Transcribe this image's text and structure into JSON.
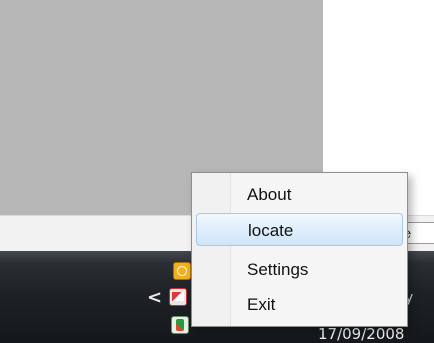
{
  "background": {
    "status_box_text": "he"
  },
  "taskbar": {
    "chevron": "<",
    "date": "17/09/2008",
    "clock_fragment": "y",
    "tray_icons": [
      {
        "name": "clock-icon"
      },
      {
        "name": "mail-icon"
      },
      {
        "name": "music-icon"
      }
    ]
  },
  "context_menu": {
    "items": [
      {
        "label": "About"
      },
      {
        "label": "locate",
        "highlighted": true
      },
      {
        "label": "Settings"
      },
      {
        "label": "Exit"
      }
    ]
  },
  "colors": {
    "menu_highlight": "#dfeefb",
    "menu_border": "#8e8e8e",
    "taskbar": "#1e2226",
    "desktop_gray": "#b7b7b7"
  }
}
